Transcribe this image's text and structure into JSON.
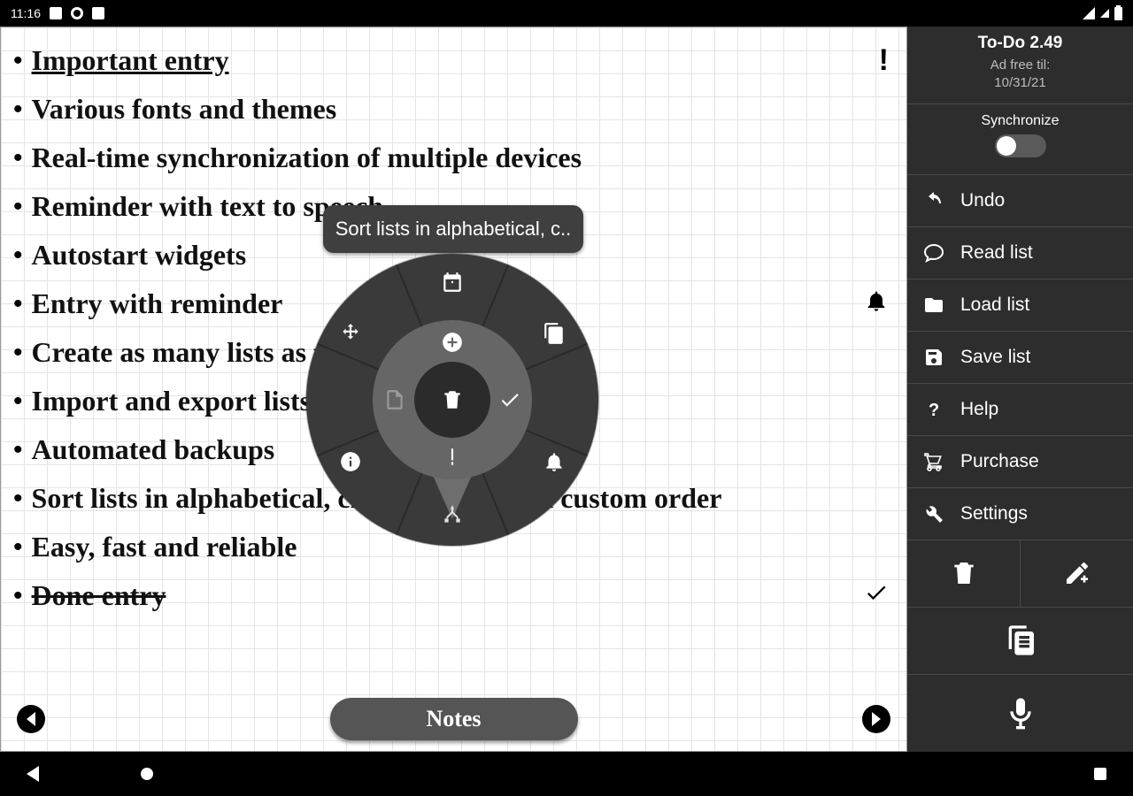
{
  "status": {
    "time": "11:16"
  },
  "sidebar": {
    "title": "To-Do 2.49",
    "adFree": "Ad free til:",
    "adDate": "10/31/21",
    "syncLabel": "Synchronize",
    "items": {
      "undo": "Undo",
      "read": "Read list",
      "load": "Load list",
      "save": "Save list",
      "help": "Help",
      "purchase": "Purchase",
      "settings": "Settings"
    }
  },
  "list": {
    "entries": [
      {
        "text": "Important entry",
        "important": true,
        "indicator": "important"
      },
      {
        "text": "Various fonts and themes"
      },
      {
        "text": "Real-time synchronization of multiple devices"
      },
      {
        "text": "Reminder with text to speech"
      },
      {
        "text": "Autostart widgets"
      },
      {
        "text": "Entry with reminder",
        "indicator": "bell"
      },
      {
        "text": "Create as many lists as you want"
      },
      {
        "text": "Import and export lists as files"
      },
      {
        "text": "Automated backups"
      },
      {
        "text": "Sort lists in alphabetical, chronological and custom order"
      },
      {
        "text": "Easy, fast and reliable"
      },
      {
        "text": "Done entry",
        "done": true,
        "indicator": "check"
      }
    ],
    "bottomButton": "Notes"
  },
  "radial": {
    "tooltip": "Sort lists in alphabetical, c.."
  }
}
